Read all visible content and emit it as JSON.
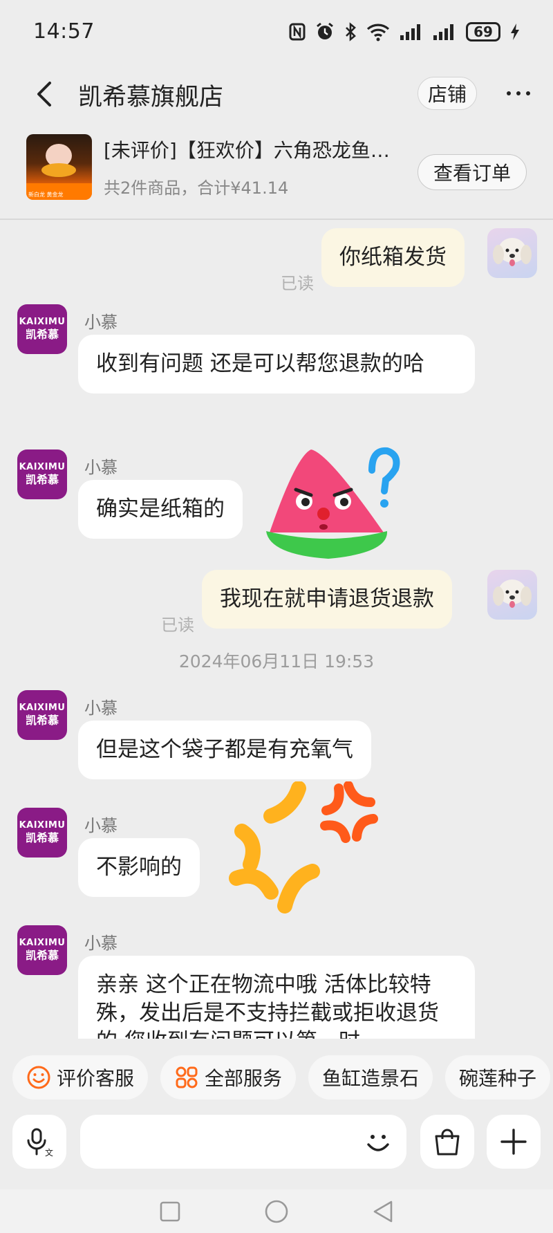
{
  "status_bar": {
    "time": "14:57",
    "battery": "69"
  },
  "header": {
    "title": "凯希慕旗舰店",
    "shop_button": "店铺"
  },
  "order": {
    "title": "[未评价]【狂欢价】六角恐龙鱼…",
    "summary": "共2件商品，合计¥41.14",
    "view_button": "查看订单"
  },
  "chat": {
    "msg1": {
      "text": "你纸箱发货",
      "read": "已读"
    },
    "msg2": {
      "sender": "小慕",
      "text": "收到有问题 还是可以帮您退款的哈"
    },
    "msg3": {
      "sender": "小慕",
      "text": "确实是纸箱的"
    },
    "msg4": {
      "text": "我现在就申请退货退款",
      "read": "已读"
    },
    "timestamp": "2024年06月11日 19:53",
    "msg5": {
      "sender": "小慕",
      "text": "但是这个袋子都是有充氧气"
    },
    "msg6": {
      "sender": "小慕",
      "text": "不影响的"
    },
    "msg7": {
      "sender": "小慕",
      "text": "亲亲 这个正在物流中哦 活体比较特殊，发出后是不支持拦截或拒收退货的 您收到有问题可以第一时"
    }
  },
  "shop_avatar": {
    "line1": "KAIXIMU",
    "line2": "凯希慕"
  },
  "quick_chips": [
    "评价客服",
    "全部服务",
    "鱼缸造景石",
    "碗莲种子"
  ],
  "input": {
    "placeholder": ""
  },
  "colors": {
    "background": "#ededed",
    "outgoing_bubble": "#fbf6e3",
    "incoming_bubble": "#ffffff",
    "shop_avatar": "#8a1b86",
    "chip_icon": "#ff6a1a"
  }
}
